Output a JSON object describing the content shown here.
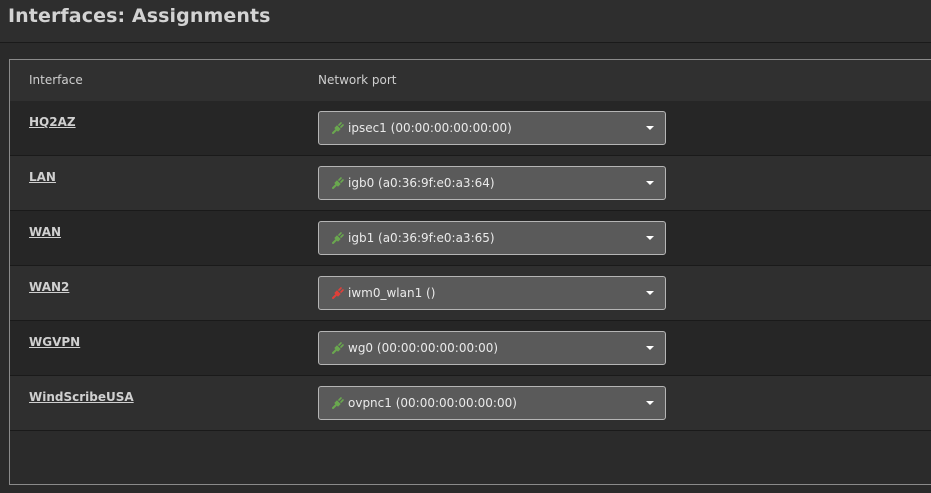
{
  "header": {
    "title": "Interfaces: Assignments"
  },
  "table": {
    "columns": {
      "interface": "Interface",
      "network_port": "Network port"
    },
    "rows": [
      {
        "interface": "HQ2AZ",
        "port": "ipsec1 (00:00:00:00:00:00)",
        "status": "up",
        "status_color": "#6aa84f"
      },
      {
        "interface": "LAN",
        "port": "igb0 (a0:36:9f:e0:a3:64)",
        "status": "up",
        "status_color": "#6aa84f"
      },
      {
        "interface": "WAN",
        "port": "igb1 (a0:36:9f:e0:a3:65)",
        "status": "up",
        "status_color": "#6aa84f"
      },
      {
        "interface": "WAN2",
        "port": "iwm0_wlan1 ()",
        "status": "down",
        "status_color": "#e0403a"
      },
      {
        "interface": "WGVPN",
        "port": "wg0 (00:00:00:00:00:00)",
        "status": "up",
        "status_color": "#6aa84f"
      },
      {
        "interface": "WindScribeUSA",
        "port": "ovpnc1 (00:00:00:00:00:00)",
        "status": "up",
        "status_color": "#6aa84f"
      }
    ]
  },
  "icons": {
    "status": "plug-icon",
    "dropdown": "caret-down-icon"
  }
}
